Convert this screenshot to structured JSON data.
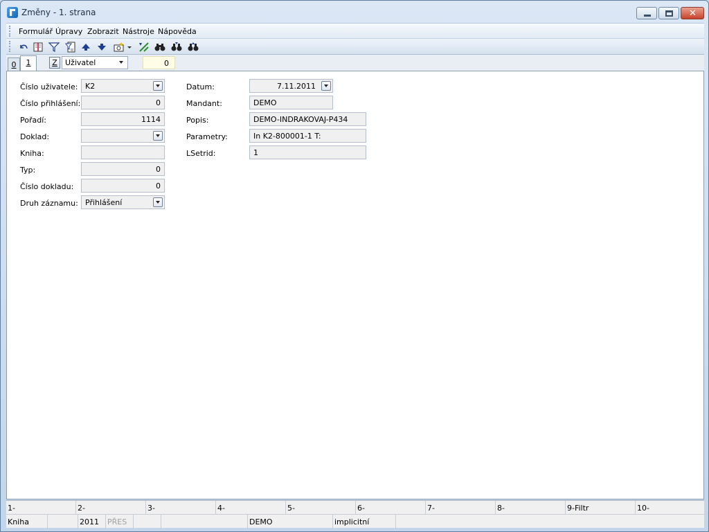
{
  "window": {
    "title": "Změny - 1. strana"
  },
  "menu": [
    "Formulář",
    "Úpravy",
    "Zobrazit",
    "Nástroje",
    "Nápověda"
  ],
  "toolbar": [
    "undo-icon",
    "book-icon",
    "filter-icon",
    "document-filter-icon",
    "arrow-up-icon",
    "arrow-down-icon",
    "camera-icon",
    "dropdown-icon",
    "export-icon",
    "binoculars-icon",
    "binoculars-next-icon",
    "binoculars-prev-icon"
  ],
  "tabs": {
    "tab0": "0",
    "tab1": "1",
    "z": "Z",
    "select_value": "Uživatel",
    "counter": "0"
  },
  "form": {
    "left": [
      {
        "label": "Číslo uživatele:",
        "value": "K2",
        "type": "combo"
      },
      {
        "label": "Číslo přihlášení:",
        "value": "0",
        "type": "num"
      },
      {
        "label": "Pořadí:",
        "value": "1114",
        "type": "num"
      },
      {
        "label": "Doklad:",
        "value": "",
        "type": "combo"
      },
      {
        "label": "Kniha:",
        "value": "",
        "type": "text"
      },
      {
        "label": "Typ:",
        "value": "0",
        "type": "num"
      },
      {
        "label": "Číslo dokladu:",
        "value": "0",
        "type": "num"
      },
      {
        "label": "Druh záznamu:",
        "value": "Přihlášení",
        "type": "combo"
      }
    ],
    "right": [
      {
        "label": "Datum:",
        "value": "7.11.2011"
      },
      {
        "label": "Mandant:",
        "value": "DEMO"
      },
      {
        "label": "Popis:",
        "value": "DEMO-INDRAKOVAJ-P434"
      },
      {
        "label": "Parametry:",
        "value": "In K2-800001-1 T:"
      },
      {
        "label": "LSetrid:",
        "value": "1"
      }
    ]
  },
  "fkeys": [
    "1-",
    "2-",
    "3-",
    "4-",
    "5-",
    "6-",
    "7-",
    "8-",
    "9-Filtr",
    "10-"
  ],
  "status": {
    "kniha": "Kniha",
    "year": "2011",
    "mode": "PŘES",
    "mandant": "DEMO",
    "profile": "implicitní"
  }
}
